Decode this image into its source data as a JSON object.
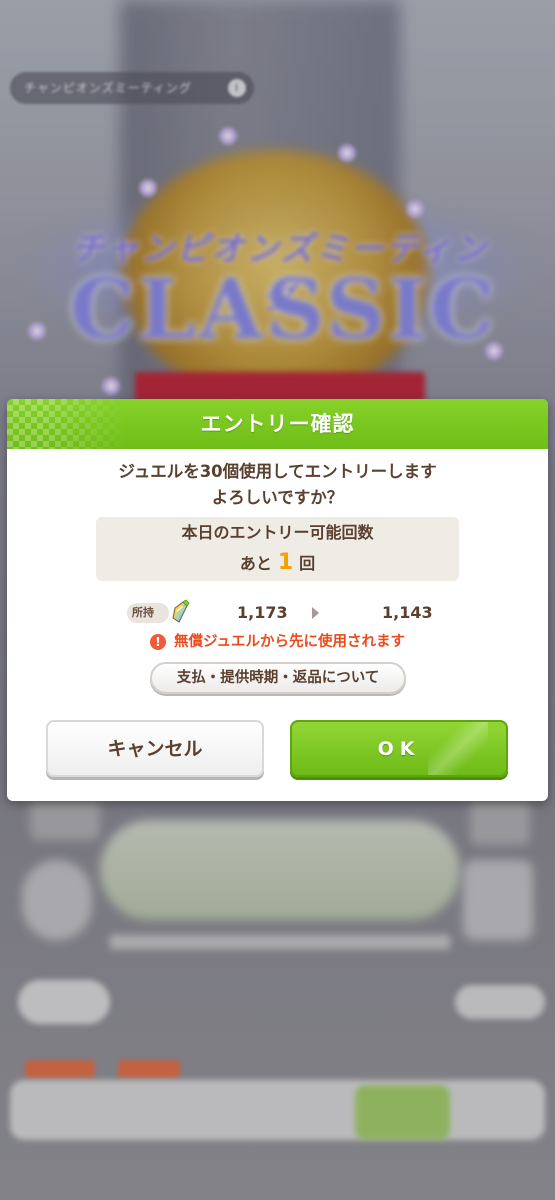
{
  "background": {
    "event_pill": "チャンピオンズミーティング",
    "event_pill_badge": "i",
    "logo_subtitle": "チャンピオンズミーティング",
    "logo_title": "CLASSIC"
  },
  "dialog": {
    "title": "エントリー確認",
    "message_line1": "ジュエルを30個使用してエントリーします",
    "message_line2": "よろしいですか？",
    "entry_count": {
      "label": "本日のエントリー可能回数",
      "prefix": "あと",
      "value": "1",
      "suffix": "回"
    },
    "owned": {
      "label": "所持",
      "icon": "jewel-icon",
      "before": "1,173",
      "after": "1,143"
    },
    "warning": {
      "icon": "warning-icon",
      "text": "無償ジュエルから先に使用されます"
    },
    "policy_button": "支払・提供時期・返品について",
    "cancel_button": "キャンセル",
    "ok_button": "OK"
  },
  "colors": {
    "accent_green": "#79c61f",
    "text_brown": "#5b4030",
    "warning_red": "#ef4a1c",
    "count_orange": "#f4a000"
  }
}
